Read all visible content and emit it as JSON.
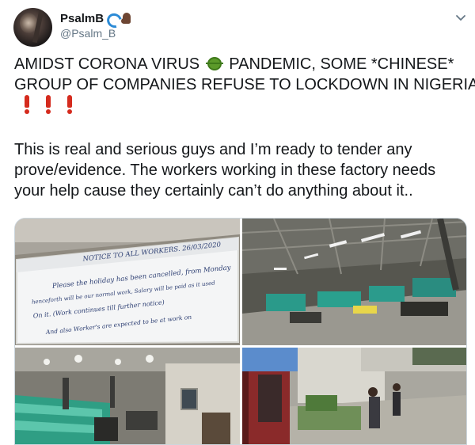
{
  "author": {
    "display_name": "PsalmB",
    "handle": "@Psalm_B",
    "name_emojis": [
      "water-wave-icon",
      "flexed-biceps-icon"
    ]
  },
  "menu": {
    "icon": "chevron-down-icon"
  },
  "tweet": {
    "headline_lines": [
      "AMIDST CORONA VIRUS",
      "PANDEMIC, SOME *CHINESE*",
      "GROUP OF COMPANIES REFUSE TO LOCKDOWN IN NIGERIA"
    ],
    "headline_emoji": "microbe-icon",
    "trailing_emojis": [
      "exclamation-icon",
      "exclamation-icon",
      "exclamation-icon"
    ],
    "body_lines": [
      "This is real and serious guys and I’m ready to tender any",
      "prove/evidence. The workers working in these factory needs",
      "your help cause they certainly can’t do anything about it.."
    ]
  },
  "media": {
    "photos": [
      {
        "subject": "whiteboard-notice",
        "board_lines": [
          "NOTICE TO ALL WORKERS. 26/03/2020",
          "Please the holiday has been cancelled, from Monday",
          "henceforth will be our normal work, Salary will be paid as it used",
          "On it. (Work continues till further notice)",
          "And also Worker's are expected to be at work on"
        ]
      },
      {
        "subject": "factory-floor"
      },
      {
        "subject": "production-line"
      },
      {
        "subject": "factory-yard"
      }
    ]
  },
  "colors": {
    "text": "#14171a",
    "secondary": "#657786",
    "border": "#ccd6dd",
    "exclamation": "#d52b1e"
  }
}
